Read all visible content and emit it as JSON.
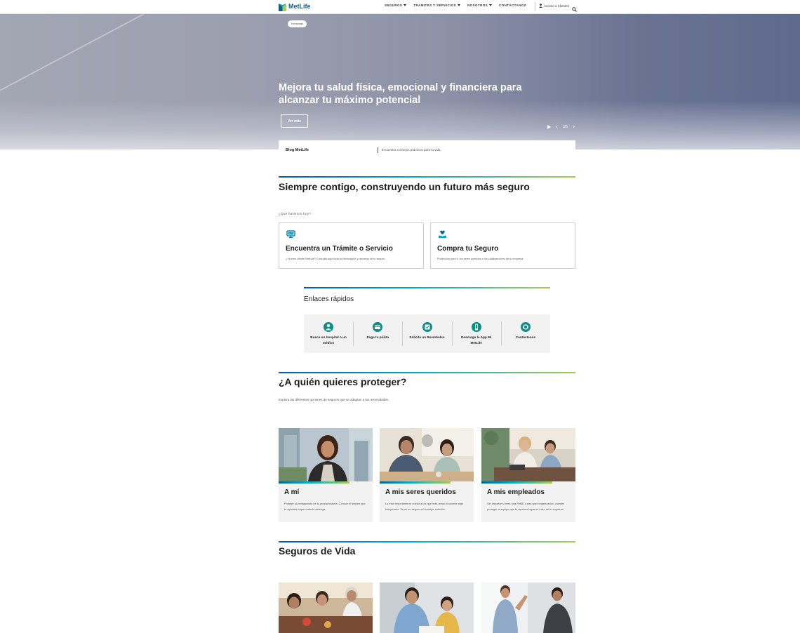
{
  "brand": {
    "name": "MetLife",
    "color_primary": "#0061a0",
    "color_accent": "#a4ce4e",
    "teal": "#0b8f86"
  },
  "header": {
    "nav": [
      "SEGUROS",
      "TRÁMITES Y SERVICIOS",
      "NOSOTROS",
      "CONTÁCTANOS"
    ],
    "account_label": "Acceso a Clientes",
    "search_icon": "search-icon"
  },
  "hero": {
    "breadcrumb": "Homepage",
    "title": "Mejora tu salud física, emocional y financiera para alcanzar tu máximo potencial",
    "cta": "Ver más",
    "slide_counter": "3/5"
  },
  "blog": {
    "name": "Blog MetLife",
    "text": "Encuentra consejos prácticos para tu vida."
  },
  "intro": {
    "title": "Siempre contigo, construyendo un futuro más seguro",
    "question": "¿Qué haremos hoy?"
  },
  "services": [
    {
      "title": "Encuentra un Trámite o Servicio",
      "desc": "¿Ya eres cliente MetLife? Consulta aquí toda la información y recursos de tu seguro.",
      "icon": "monitor-icon"
    },
    {
      "title": "Compra tu Seguro",
      "desc": "Protección para ti, tus seres queridos o los colaboradores de tu empresa.",
      "icon": "heart-hand-icon"
    }
  ],
  "quick_links": {
    "title": "Enlaces rápidos",
    "items": [
      {
        "label": "Busca un hospital o un médico",
        "icon": "doctor-icon"
      },
      {
        "label": "Paga tu póliza",
        "icon": "card-icon"
      },
      {
        "label": "Solicita un Reembolso",
        "icon": "refund-icon"
      },
      {
        "label": "Descarga la App Mi MetLife",
        "icon": "phone-icon"
      },
      {
        "label": "Contáctanos",
        "icon": "contact-icon"
      }
    ]
  },
  "protect": {
    "title": "¿A quién quieres proteger?",
    "subtitle": "Explora las diferentes opciones de seguros que se adaptan a tus necesidades.",
    "cards": [
      {
        "title": "A mí",
        "desc": "Protege al protagonista de tu propia historia. Conoce el seguro que te ayudará a que nada te detenga."
      },
      {
        "title": "A mis seres queridos",
        "desc": "Lo más importante es cuidar a los que más amas si sucede algo inesperado. Tener un seguro es la mejor solución."
      },
      {
        "title": "A mis empleados",
        "desc": "Sin importar si eres una PyME o una gran organización, puedes proteger al equipo que te ayuda a lograr el éxito de tu empresa."
      }
    ]
  },
  "life": {
    "title": "Seguros de Vida"
  }
}
